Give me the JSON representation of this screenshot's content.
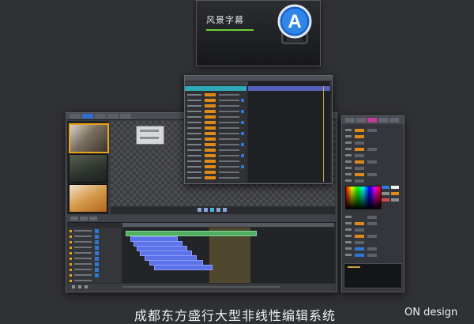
{
  "splash": {
    "title": "风景字幕"
  },
  "main_window": {
    "tabs": [
      {
        "id": "t1"
      },
      {
        "id": "t2",
        "active": true
      },
      {
        "id": "t3"
      },
      {
        "id": "t4"
      },
      {
        "id": "t5"
      }
    ],
    "thumbnails": [
      {
        "name": "thumb-1",
        "selected": true,
        "colors": [
          "#d9d3c8",
          "#3b342c"
        ]
      },
      {
        "name": "thumb-2",
        "selected": false,
        "colors": [
          "#3f4a40",
          "#1d2320"
        ]
      },
      {
        "name": "thumb-3",
        "selected": false,
        "colors": [
          "#f1e3c7",
          "#b3651f"
        ]
      }
    ],
    "timeline_tracks": 10
  },
  "bottom": {
    "caption": "成都东方盛行大型非线性编辑系统",
    "brand": "ON design"
  },
  "colors": {
    "accent_blue": "#2f79d6",
    "accent_orange": "#e08a17",
    "selection_cyan": "#2fa8b8",
    "thumb_selected": "#e8a317",
    "clip_blue": "#5b72e8",
    "clip_green": "#4fae62",
    "magenta_tab": "#c23b9b"
  },
  "icons": {
    "splash_logo": "letter-a-logo-icon",
    "play": "play-icon",
    "stop": "stop-icon",
    "rewind": "rewind-icon",
    "forward": "forward-icon"
  }
}
